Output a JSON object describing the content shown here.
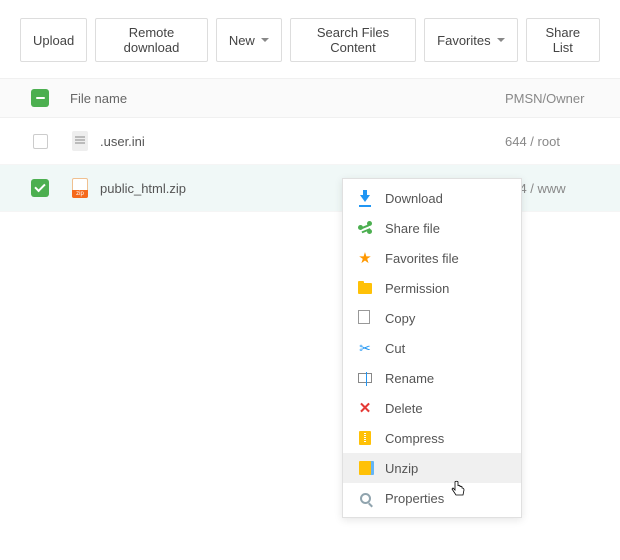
{
  "toolbar": {
    "upload": "Upload",
    "remote_download": "Remote download",
    "new": "New",
    "search": "Search Files Content",
    "favorites": "Favorites",
    "share_list": "Share List"
  },
  "header": {
    "filename": "File name",
    "permission": "PMSN/Owner"
  },
  "files": [
    {
      "name": ".user.ini",
      "perm": "644 / root"
    },
    {
      "name": "public_html.zip",
      "perm": "644 / www"
    }
  ],
  "menu": {
    "download": "Download",
    "share": "Share file",
    "favorites": "Favorites file",
    "permission": "Permission",
    "copy": "Copy",
    "cut": "Cut",
    "rename": "Rename",
    "delete": "Delete",
    "compress": "Compress",
    "unzip": "Unzip",
    "properties": "Properties"
  }
}
